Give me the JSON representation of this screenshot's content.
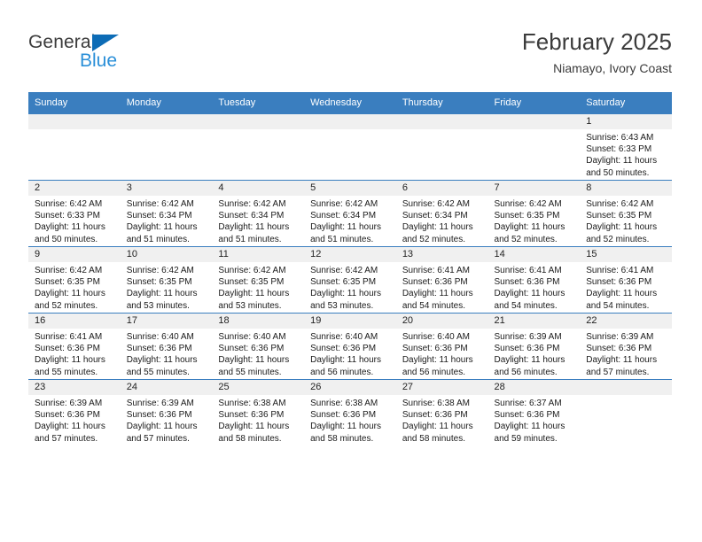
{
  "brand": {
    "name_part1": "General",
    "name_part2": "Blue",
    "triangle_color": "#0d6cb6",
    "blue_color": "#2a8fd8"
  },
  "header": {
    "month_title": "February 2025",
    "location": "Niamayo, Ivory Coast"
  },
  "theme": {
    "header_row_bg": "#3a7ebf",
    "row_separator": "#3a7ebf",
    "daynum_band_bg": "#f0f0f0"
  },
  "weekdays": [
    "Sunday",
    "Monday",
    "Tuesday",
    "Wednesday",
    "Thursday",
    "Friday",
    "Saturday"
  ],
  "weeks": [
    [
      {
        "day": "",
        "sunrise": "",
        "sunset": "",
        "daylight": "",
        "blank": true
      },
      {
        "day": "",
        "sunrise": "",
        "sunset": "",
        "daylight": "",
        "blank": true
      },
      {
        "day": "",
        "sunrise": "",
        "sunset": "",
        "daylight": "",
        "blank": true
      },
      {
        "day": "",
        "sunrise": "",
        "sunset": "",
        "daylight": "",
        "blank": true
      },
      {
        "day": "",
        "sunrise": "",
        "sunset": "",
        "daylight": "",
        "blank": true
      },
      {
        "day": "",
        "sunrise": "",
        "sunset": "",
        "daylight": "",
        "blank": true
      },
      {
        "day": "1",
        "sunrise": "Sunrise: 6:43 AM",
        "sunset": "Sunset: 6:33 PM",
        "daylight": "Daylight: 11 hours and 50 minutes."
      }
    ],
    [
      {
        "day": "2",
        "sunrise": "Sunrise: 6:42 AM",
        "sunset": "Sunset: 6:33 PM",
        "daylight": "Daylight: 11 hours and 50 minutes."
      },
      {
        "day": "3",
        "sunrise": "Sunrise: 6:42 AM",
        "sunset": "Sunset: 6:34 PM",
        "daylight": "Daylight: 11 hours and 51 minutes."
      },
      {
        "day": "4",
        "sunrise": "Sunrise: 6:42 AM",
        "sunset": "Sunset: 6:34 PM",
        "daylight": "Daylight: 11 hours and 51 minutes."
      },
      {
        "day": "5",
        "sunrise": "Sunrise: 6:42 AM",
        "sunset": "Sunset: 6:34 PM",
        "daylight": "Daylight: 11 hours and 51 minutes."
      },
      {
        "day": "6",
        "sunrise": "Sunrise: 6:42 AM",
        "sunset": "Sunset: 6:34 PM",
        "daylight": "Daylight: 11 hours and 52 minutes."
      },
      {
        "day": "7",
        "sunrise": "Sunrise: 6:42 AM",
        "sunset": "Sunset: 6:35 PM",
        "daylight": "Daylight: 11 hours and 52 minutes."
      },
      {
        "day": "8",
        "sunrise": "Sunrise: 6:42 AM",
        "sunset": "Sunset: 6:35 PM",
        "daylight": "Daylight: 11 hours and 52 minutes."
      }
    ],
    [
      {
        "day": "9",
        "sunrise": "Sunrise: 6:42 AM",
        "sunset": "Sunset: 6:35 PM",
        "daylight": "Daylight: 11 hours and 52 minutes."
      },
      {
        "day": "10",
        "sunrise": "Sunrise: 6:42 AM",
        "sunset": "Sunset: 6:35 PM",
        "daylight": "Daylight: 11 hours and 53 minutes."
      },
      {
        "day": "11",
        "sunrise": "Sunrise: 6:42 AM",
        "sunset": "Sunset: 6:35 PM",
        "daylight": "Daylight: 11 hours and 53 minutes."
      },
      {
        "day": "12",
        "sunrise": "Sunrise: 6:42 AM",
        "sunset": "Sunset: 6:35 PM",
        "daylight": "Daylight: 11 hours and 53 minutes."
      },
      {
        "day": "13",
        "sunrise": "Sunrise: 6:41 AM",
        "sunset": "Sunset: 6:36 PM",
        "daylight": "Daylight: 11 hours and 54 minutes."
      },
      {
        "day": "14",
        "sunrise": "Sunrise: 6:41 AM",
        "sunset": "Sunset: 6:36 PM",
        "daylight": "Daylight: 11 hours and 54 minutes."
      },
      {
        "day": "15",
        "sunrise": "Sunrise: 6:41 AM",
        "sunset": "Sunset: 6:36 PM",
        "daylight": "Daylight: 11 hours and 54 minutes."
      }
    ],
    [
      {
        "day": "16",
        "sunrise": "Sunrise: 6:41 AM",
        "sunset": "Sunset: 6:36 PM",
        "daylight": "Daylight: 11 hours and 55 minutes."
      },
      {
        "day": "17",
        "sunrise": "Sunrise: 6:40 AM",
        "sunset": "Sunset: 6:36 PM",
        "daylight": "Daylight: 11 hours and 55 minutes."
      },
      {
        "day": "18",
        "sunrise": "Sunrise: 6:40 AM",
        "sunset": "Sunset: 6:36 PM",
        "daylight": "Daylight: 11 hours and 55 minutes."
      },
      {
        "day": "19",
        "sunrise": "Sunrise: 6:40 AM",
        "sunset": "Sunset: 6:36 PM",
        "daylight": "Daylight: 11 hours and 56 minutes."
      },
      {
        "day": "20",
        "sunrise": "Sunrise: 6:40 AM",
        "sunset": "Sunset: 6:36 PM",
        "daylight": "Daylight: 11 hours and 56 minutes."
      },
      {
        "day": "21",
        "sunrise": "Sunrise: 6:39 AM",
        "sunset": "Sunset: 6:36 PM",
        "daylight": "Daylight: 11 hours and 56 minutes."
      },
      {
        "day": "22",
        "sunrise": "Sunrise: 6:39 AM",
        "sunset": "Sunset: 6:36 PM",
        "daylight": "Daylight: 11 hours and 57 minutes."
      }
    ],
    [
      {
        "day": "23",
        "sunrise": "Sunrise: 6:39 AM",
        "sunset": "Sunset: 6:36 PM",
        "daylight": "Daylight: 11 hours and 57 minutes."
      },
      {
        "day": "24",
        "sunrise": "Sunrise: 6:39 AM",
        "sunset": "Sunset: 6:36 PM",
        "daylight": "Daylight: 11 hours and 57 minutes."
      },
      {
        "day": "25",
        "sunrise": "Sunrise: 6:38 AM",
        "sunset": "Sunset: 6:36 PM",
        "daylight": "Daylight: 11 hours and 58 minutes."
      },
      {
        "day": "26",
        "sunrise": "Sunrise: 6:38 AM",
        "sunset": "Sunset: 6:36 PM",
        "daylight": "Daylight: 11 hours and 58 minutes."
      },
      {
        "day": "27",
        "sunrise": "Sunrise: 6:38 AM",
        "sunset": "Sunset: 6:36 PM",
        "daylight": "Daylight: 11 hours and 58 minutes."
      },
      {
        "day": "28",
        "sunrise": "Sunrise: 6:37 AM",
        "sunset": "Sunset: 6:36 PM",
        "daylight": "Daylight: 11 hours and 59 minutes."
      },
      {
        "day": "",
        "sunrise": "",
        "sunset": "",
        "daylight": "",
        "blank": true
      }
    ]
  ]
}
